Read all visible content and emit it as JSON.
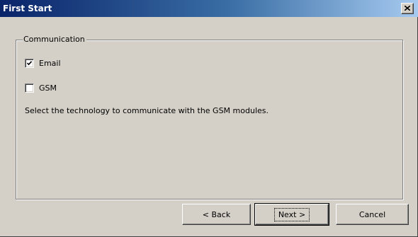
{
  "window": {
    "title": "First Start",
    "close_icon": "close-icon"
  },
  "group": {
    "label": "Communication",
    "options": [
      {
        "label": "Email",
        "checked": true
      },
      {
        "label": "GSM",
        "checked": false
      }
    ],
    "description": "Select the technology to communicate with the GSM modules."
  },
  "buttons": {
    "back": "< Back",
    "next": "Next >",
    "cancel": "Cancel"
  },
  "colors": {
    "titlebar_start": "#0a246a",
    "titlebar_end": "#a6caf0",
    "face": "#d4d0c8"
  }
}
